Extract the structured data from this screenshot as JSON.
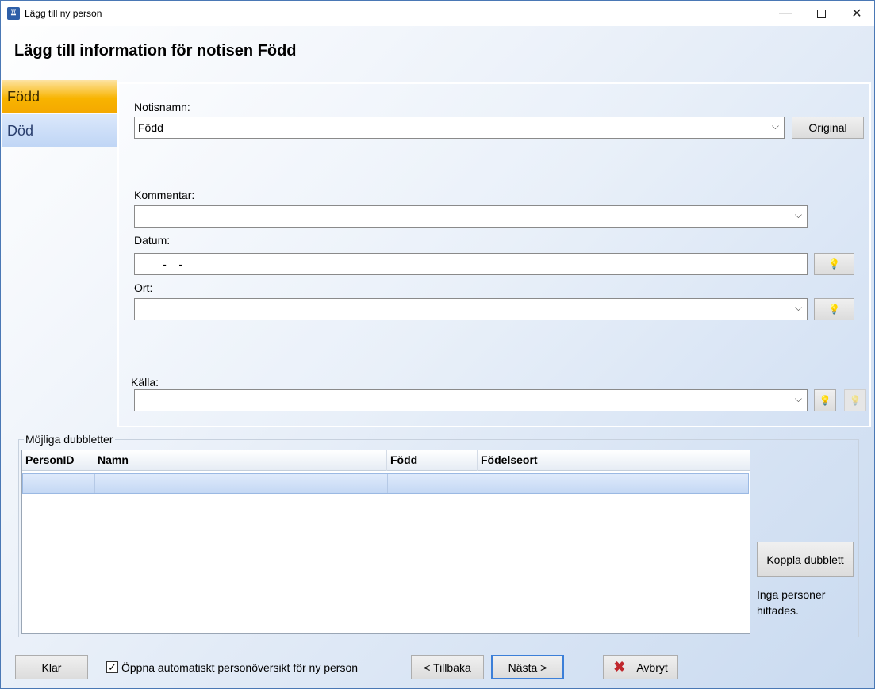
{
  "window": {
    "title": "Lägg till ny person",
    "minimize_glyph": "—",
    "close_glyph": "✕"
  },
  "heading": "Lägg till information för notisen Född",
  "sidebar": {
    "items": [
      {
        "label": "Född",
        "selected": true
      },
      {
        "label": "Död",
        "selected": false
      }
    ]
  },
  "form": {
    "notisnamn": {
      "label": "Notisnamn:",
      "value": "Född",
      "button": "Original"
    },
    "kommentar": {
      "label": "Kommentar:",
      "value": ""
    },
    "datum": {
      "label": "Datum:",
      "value": "____-__-__"
    },
    "ort": {
      "label": "Ort:",
      "value": ""
    },
    "kalla": {
      "label": "Källa:",
      "value": ""
    }
  },
  "duplicates": {
    "legend": "Möjliga dubbletter",
    "columns": [
      "PersonID",
      "Namn",
      "Född",
      "Födelseort"
    ],
    "link_button": "Koppla dubblett",
    "status": "Inga personer hittades."
  },
  "footer": {
    "done": "Klar",
    "auto_open": {
      "label": "Öppna automatiskt personöversikt för ny person",
      "checked": true,
      "glyph": "✓"
    },
    "back": "< Tillbaka",
    "next": "Nästa >",
    "cancel": "Avbryt",
    "cancel_glyph": "✖"
  },
  "icons": {
    "bulb": "💡",
    "bulb_off": "💡",
    "dropdown": "⌵"
  },
  "colors": {
    "selected_tab": "#f8b400",
    "accent_border": "#3c7fd8",
    "cancel_icon": "#c0282d"
  }
}
